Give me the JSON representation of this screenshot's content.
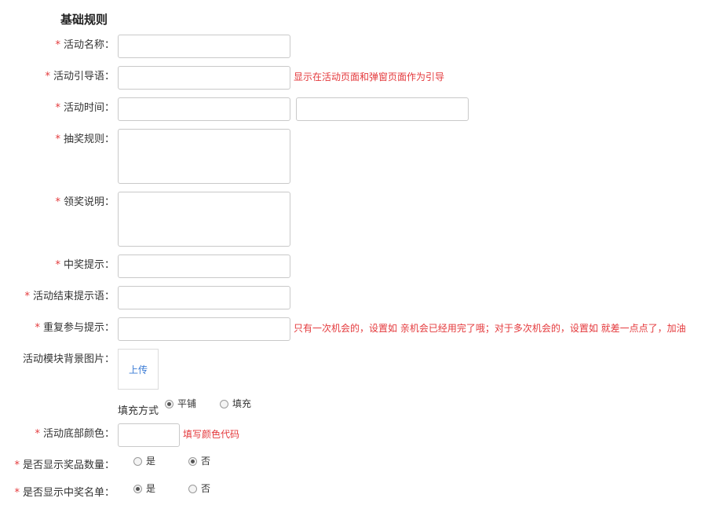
{
  "section_title": "基础规则",
  "required_mark": "*",
  "fields": {
    "name": {
      "label": "活动名称：",
      "value": ""
    },
    "guide": {
      "label": "活动引导语：",
      "value": "",
      "hint": "显示在活动页面和弹窗页面作为引导"
    },
    "time": {
      "label": "活动时间：",
      "start": "",
      "end": ""
    },
    "rules": {
      "label": "抽奖规则：",
      "value": ""
    },
    "claim": {
      "label": "领奖说明：",
      "value": ""
    },
    "win_tip": {
      "label": "中奖提示：",
      "value": ""
    },
    "end_tip": {
      "label": "活动结束提示语：",
      "value": ""
    },
    "repeat_tip": {
      "label": "重复参与提示：",
      "value": "",
      "hint": "只有一次机会的，设置如 亲机会已经用完了哦；对于多次机会的，设置如 就差一点点了，加油"
    },
    "bg_image": {
      "label": "活动模块背景图片：",
      "upload_label": "上传"
    },
    "fill_mode": {
      "label": "填充方式",
      "options": [
        "平铺",
        "填充"
      ],
      "selected": "平铺"
    },
    "bottom_color": {
      "label": "活动底部颜色：",
      "value": "",
      "hint": "填写颜色代码"
    },
    "show_prize_count": {
      "label": "是否显示奖品数量：",
      "options": [
        "是",
        "否"
      ],
      "selected": "否"
    },
    "show_winner_list": {
      "label": "是否显示中奖名单：",
      "options": [
        "是",
        "否"
      ],
      "selected": "是"
    }
  }
}
